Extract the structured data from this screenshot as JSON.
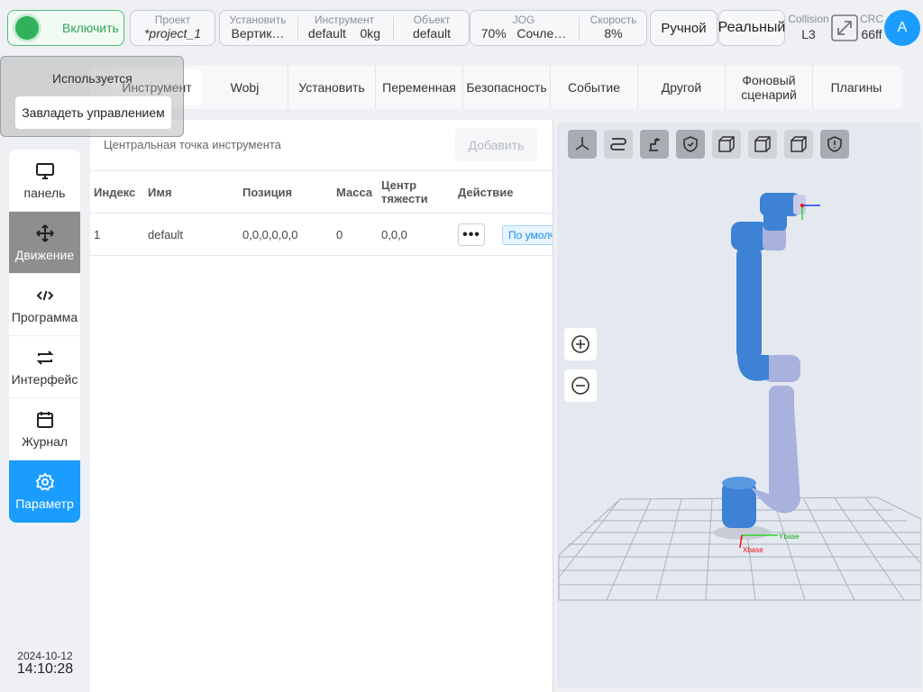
{
  "topbar": {
    "enable_label": "Включить",
    "project_label": "Проект",
    "project_value": "*project_1",
    "install_label": "Установить",
    "install_value": "Вертик…",
    "tool_label": "Инструмент",
    "tool_value": "default",
    "tool_mass": "0kg",
    "object_label": "Объект",
    "object_value": "default",
    "jog_label": "JOG",
    "jog_value": "70%",
    "jog_mode": "Сочле…",
    "speed_label": "Скорость",
    "speed_value": "8%",
    "mode_button": "Ручной",
    "real_button": "Реальный",
    "collision_label": "Collision",
    "collision_value": "L3",
    "crc_label": "CRC",
    "crc_value": "66ff",
    "avatar_letter": "A"
  },
  "overlay": {
    "status_text": "Используется",
    "take_control_button": "Завладеть управлением"
  },
  "tabs": [
    {
      "label": "Инструмент"
    },
    {
      "label": "Wobj"
    },
    {
      "label": "Установить"
    },
    {
      "label": "Переменная"
    },
    {
      "label": "Безопасность"
    },
    {
      "label": "Событие"
    },
    {
      "label": "Другой"
    },
    {
      "label": "Фоновый сценарий"
    },
    {
      "label": "Плагины"
    }
  ],
  "sidebar": {
    "items": [
      {
        "label": "панель",
        "icon": "monitor-icon"
      },
      {
        "label": "Движение",
        "icon": "move-icon"
      },
      {
        "label": "Программа",
        "icon": "code-icon"
      },
      {
        "label": "Интерфейс",
        "icon": "swap-icon"
      },
      {
        "label": "Журнал",
        "icon": "calendar-icon"
      },
      {
        "label": "Параметр",
        "icon": "gear-icon"
      }
    ],
    "date": "2024-10-12",
    "time": "14:10:28"
  },
  "panel": {
    "title": "Центральная точка инструмента",
    "add_button": "Добавить",
    "columns": [
      "Индекс",
      "Имя",
      "Позиция",
      "Масса",
      "Центр тяжести",
      "Действие"
    ],
    "rows": [
      {
        "index": "1",
        "name": "default",
        "position": "0,0,0,0,0,0",
        "mass": "0",
        "cog": "0,0,0",
        "tag": "По умолч"
      }
    ]
  },
  "view3d": {
    "axis_x": "Xbase",
    "axis_y": "Ybase"
  }
}
